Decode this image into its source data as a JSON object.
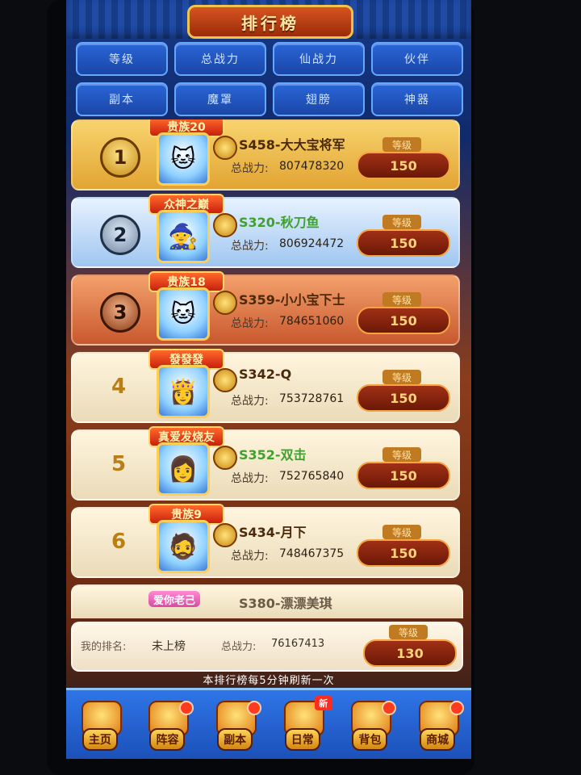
{
  "header": {
    "title": "排行榜"
  },
  "tabs": [
    "等级",
    "总战力",
    "仙战力",
    "伙伴",
    "副本",
    "魔罩",
    "翅膀",
    "神器"
  ],
  "ranking_rows": [
    {
      "rank": "1",
      "title_tag": "贵族20",
      "name": "S458-大大宝将军",
      "power_label": "总战力:",
      "power": "807478320",
      "level_label": "等级",
      "level": "150",
      "style": "gold"
    },
    {
      "rank": "2",
      "title_tag": "众神之巅",
      "name": "S320-秋刀鱼",
      "power_label": "总战力:",
      "power": "806924472",
      "level_label": "等级",
      "level": "150",
      "style": "silver"
    },
    {
      "rank": "3",
      "title_tag": "贵族18",
      "name": "S359-小小宝下士",
      "power_label": "总战力:",
      "power": "784651060",
      "level_label": "等级",
      "level": "150",
      "style": "bronze"
    },
    {
      "rank": "4",
      "title_tag": "發發發",
      "name": "S342-Q",
      "power_label": "总战力:",
      "power": "753728761",
      "level_label": "等级",
      "level": "150",
      "style": "plain"
    },
    {
      "rank": "5",
      "title_tag": "真爱发烧友",
      "name": "S352-双击",
      "power_label": "总战力:",
      "power": "752765840",
      "level_label": "等级",
      "level": "150",
      "style": "plain"
    },
    {
      "rank": "6",
      "title_tag": "贵族9",
      "name": "S434-月下",
      "power_label": "总战力:",
      "power": "748467375",
      "level_label": "等级",
      "level": "150",
      "style": "plain"
    }
  ],
  "partial_row": {
    "title_tag": "爱你老己",
    "name": "S380-漂漂美琪"
  },
  "my_rank": {
    "label": "我的排名:",
    "status": "未上榜",
    "power_label": "总战力:",
    "power": "76167413",
    "level_label": "等级",
    "level": "130"
  },
  "refresh_note": "本排行榜每5分钟刷新一次",
  "nav": [
    {
      "label": "主页",
      "icon": "home-icon"
    },
    {
      "label": "阵容",
      "icon": "lineup-icon"
    },
    {
      "label": "副本",
      "icon": "dungeon-icon"
    },
    {
      "label": "日常",
      "icon": "daily-icon",
      "new": "新"
    },
    {
      "label": "背包",
      "icon": "bag-icon"
    },
    {
      "label": "商城",
      "icon": "shop-icon"
    }
  ]
}
